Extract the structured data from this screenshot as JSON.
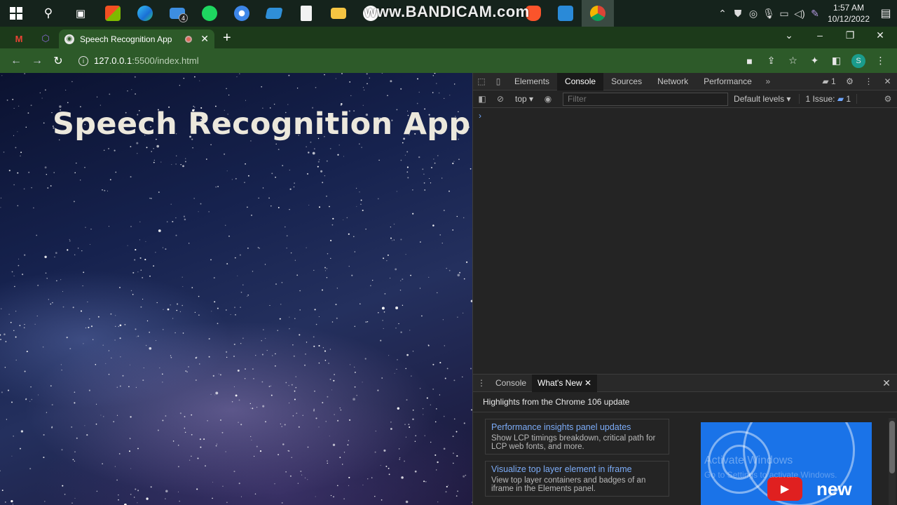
{
  "taskbar": {
    "apps": [
      {
        "name": "start",
        "color": "#ffffff"
      },
      {
        "name": "search",
        "color": "#ffffff"
      },
      {
        "name": "task-view",
        "color": "#ffffff"
      },
      {
        "name": "store",
        "color": "#f25022"
      },
      {
        "name": "edge",
        "color": "#1fa0e3"
      },
      {
        "name": "mail",
        "color": "#3d8ee0",
        "badge": "4"
      },
      {
        "name": "spotify",
        "color": "#1ed760"
      },
      {
        "name": "app-blue",
        "color": "#4aa3f0"
      },
      {
        "name": "app-slides",
        "color": "#2f8fd8"
      },
      {
        "name": "notepad",
        "color": "#f2f2f2"
      },
      {
        "name": "explorer",
        "color": "#f5c542"
      }
    ],
    "watermark": "www.BANDICAM.com",
    "clock_time": "1:57 AM",
    "clock_date": "10/12/2022"
  },
  "browser": {
    "tab_title": "Speech Recognition App",
    "url_host": "127.0.0.1",
    "url_path": ":5500/index.html",
    "avatar_letter": "S"
  },
  "page": {
    "title": "Speech Recognition App"
  },
  "devtools": {
    "tabs": [
      "Elements",
      "Console",
      "Sources",
      "Network",
      "Performance"
    ],
    "selected_tab": "Console",
    "msg_count": "1",
    "context": "top",
    "filter_placeholder": "Filter",
    "levels": "Default levels",
    "issues_label": "1 Issue:",
    "issues_count": "1",
    "drawer": {
      "tabs": [
        "Console",
        "What's New"
      ],
      "highlights": "Highlights from the Chrome 106 update",
      "cards": [
        {
          "title": "Performance insights panel updates",
          "desc": "Show LCP timings breakdown, critical path for LCP web fonts, and more."
        },
        {
          "title": "Visualize top layer element in iframe",
          "desc": "View top layer containers and badges of an iframe in the Elements panel."
        }
      ],
      "promo_text": "new",
      "activate_title": "Activate Windows",
      "activate_sub": "Go to Settings to activate Windows."
    }
  }
}
